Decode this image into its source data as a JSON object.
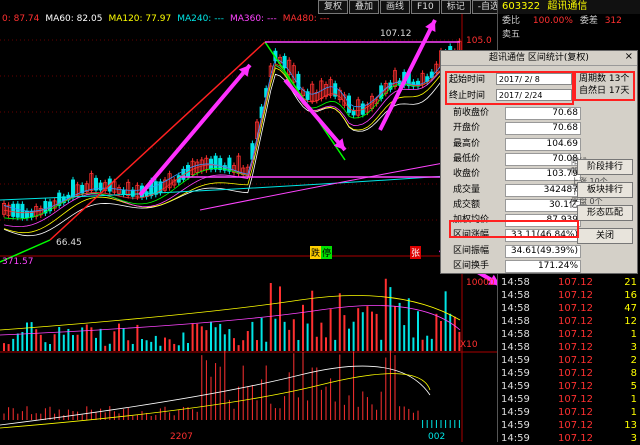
{
  "ma_legend": [
    {
      "label": "0: 87.74",
      "color": "#ff3030"
    },
    {
      "label": "MA60: 82.05",
      "color": "#ffffff"
    },
    {
      "label": "MA120: 77.97",
      "color": "#ffff00"
    },
    {
      "label": "MA240: ---",
      "color": "#00e5e5"
    },
    {
      "label": "MA360: ---",
      "color": "#ff44ff"
    },
    {
      "label": "MA480: ---",
      "color": "#ff3030"
    }
  ],
  "toolbar": [
    "复权",
    "叠加",
    "画线",
    "F10",
    "标记",
    "-自选",
    "返回"
  ],
  "stock": {
    "code": "603322",
    "name": "超讯通信",
    "weibi_label": "委比",
    "weibi_value": "100.00%",
    "weicha_label": "委差",
    "weicha_value": "312",
    "sell5_label": "卖五"
  },
  "price_labels": {
    "high": "107.12",
    "low": "66.45",
    "ref_top": "105.0",
    "vol_axis": "10000",
    "vol_left": "371.57",
    "x10": "X10",
    "macd_val": "2207",
    "macd_right": "002"
  },
  "chart_marks": {
    "die": "跌",
    "ting": "停",
    "zhang": "张"
  },
  "dialog": {
    "title": "超讯通信 区间统计(复权)",
    "close": "×",
    "start_label": "起始时间",
    "start_value": "2017/ 2/ 8",
    "end_label": "终止时间",
    "end_value": "2017/ 2/24",
    "period_label": "周期数",
    "period_value": "13个",
    "days_label": "自然日",
    "days_value": "17天",
    "rows": [
      {
        "label": "前收盘价",
        "value": "70.68"
      },
      {
        "label": "开盘价",
        "value": "70.68"
      },
      {
        "label": "最高价",
        "value": "104.69"
      },
      {
        "label": "最低价",
        "value": "70.08"
      },
      {
        "label": "收盘价",
        "value": "103.79"
      },
      {
        "label": "成交量",
        "value": "342487"
      },
      {
        "label": "成交额",
        "value": "30.1亿"
      },
      {
        "label": "加权均价",
        "value": "87.939"
      },
      {
        "label": "区间涨幅",
        "value": "33.11(46.84%)"
      },
      {
        "label": "区间振幅",
        "value": "34.61(49.39%)"
      },
      {
        "label": "区间换手",
        "value": "171.24%"
      }
    ],
    "stats": [
      "阳线",
      "阴线",
      "上涨 10个",
      "下跌 3个",
      "平盘 0个"
    ],
    "buttons": [
      "阶段排行",
      "板块排行",
      "形态匹配",
      "关闭"
    ]
  },
  "ticks": [
    {
      "time": "14:58",
      "price": "107.12",
      "vol": "21"
    },
    {
      "time": "14:58",
      "price": "107.12",
      "vol": "16"
    },
    {
      "time": "14:58",
      "price": "107.12",
      "vol": "47"
    },
    {
      "time": "14:58",
      "price": "107.12",
      "vol": "12"
    },
    {
      "time": "14:58",
      "price": "107.12",
      "vol": "1"
    },
    {
      "time": "14:58",
      "price": "107.12",
      "vol": "3"
    },
    {
      "time": "14:59",
      "price": "107.12",
      "vol": "2"
    },
    {
      "time": "14:59",
      "price": "107.12",
      "vol": "8"
    },
    {
      "time": "14:59",
      "price": "107.12",
      "vol": "5"
    },
    {
      "time": "14:59",
      "price": "107.12",
      "vol": "1"
    },
    {
      "time": "14:59",
      "price": "107.12",
      "vol": "1"
    },
    {
      "time": "14:59",
      "price": "107.12",
      "vol": "13"
    },
    {
      "time": "14:59",
      "price": "107.12",
      "vol": "3"
    }
  ]
}
